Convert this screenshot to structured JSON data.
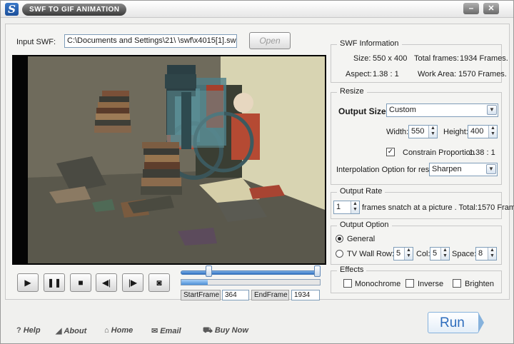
{
  "window": {
    "title": "SWF TO GIF ANIMATION",
    "app_icon": "swf-logo-icon",
    "min_glyph": "–",
    "close_glyph": "✕"
  },
  "input": {
    "label": "Input SWF:",
    "path": "C:\\Documents and Settings\\21\\        \\swf\\x4015[1].sw",
    "open_label": "Open"
  },
  "preview": {
    "description_icon": "swf-preview-frame"
  },
  "controls": {
    "play": "▶",
    "pause": "❚❚",
    "stop": "■",
    "prev": "◀|",
    "next": "|▶",
    "snapshot": "📷"
  },
  "timeline": {
    "range_start_frac": 0.2,
    "range_end_frac": 1.0,
    "progress_frac": 0.19,
    "start_label": "StartFrame",
    "start_value": "364",
    "end_label": "EndFrame",
    "end_value": "1934"
  },
  "swf_info": {
    "title": "SWF Information",
    "size_label": "Size:",
    "size_value": "550 x 400",
    "frames_label": "Total frames:",
    "frames_value": "1934 Frames.",
    "aspect_label": "Aspect:",
    "aspect_value": "1.38 : 1",
    "work_label": "Work Area:",
    "work_value": "1570 Frames."
  },
  "resize": {
    "title": "Resize",
    "output_size_label": "Output Size:",
    "output_size_value": "Custom",
    "width_label": "Width:",
    "width_value": "550",
    "height_label": "Height:",
    "height_value": "400",
    "constrain_checked": true,
    "constrain_label": "Constrain Proportion",
    "constrain_ratio": "1.38 : 1",
    "interp_label": "Interpolation Option for resize:",
    "interp_value": "Sharpen"
  },
  "output_rate": {
    "title": "Output Rate",
    "value": "1",
    "suffix": "frames snatch at a picture . Total:1570 Frames."
  },
  "output_option": {
    "title": "Output Option",
    "general_label": "General",
    "general_selected": true,
    "tvwall_label": "TV Wall",
    "tvwall_selected": false,
    "row_label": "Row:",
    "row_value": "5",
    "col_label": "Col:",
    "col_value": "5",
    "space_label": "Space:",
    "space_value": "8"
  },
  "effects": {
    "title": "Effects",
    "monochrome_label": "Monochrome",
    "monochrome_checked": false,
    "inverse_label": "Inverse",
    "inverse_checked": false,
    "brighten_label": "Brighten",
    "brighten_checked": false
  },
  "footer": {
    "help_icon": "?",
    "help_label": "Help",
    "about_icon": "◢",
    "about_label": "About",
    "home_icon": "⌂",
    "home_label": "Home",
    "email_icon": "✉",
    "email_label": "Email",
    "buynow_icon": "⛟",
    "buynow_label": "Buy Now"
  },
  "run": {
    "label": "Run"
  },
  "colors": {
    "accent": "#2e6dbd",
    "slider": "#2e6fc0",
    "preview_bg": "#050505"
  }
}
